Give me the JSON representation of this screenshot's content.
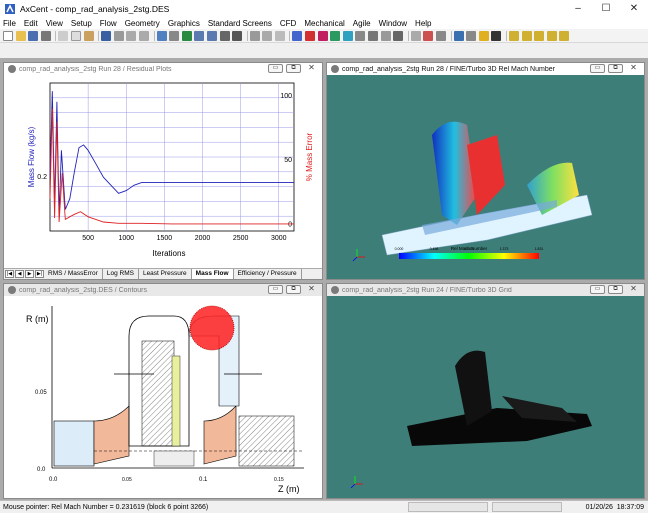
{
  "window": {
    "title": "AxCent - comp_rad_analysis_2stg.DES",
    "controls": [
      "–",
      "☐",
      "✕"
    ]
  },
  "menu": [
    "File",
    "Edit",
    "View",
    "Setup",
    "Flow",
    "Geometry",
    "Graphics",
    "Standard Screens",
    "CFD",
    "Mechanical",
    "Agile",
    "Window",
    "Help"
  ],
  "panes": {
    "residual": {
      "title": "comp_rad_analysis_2stg Run 28 / Residual Plots",
      "tabs": [
        "RMS / MassError",
        "Log RMS",
        "Least Pressure",
        "Mass Flow",
        "Efficiency / Pressure"
      ],
      "selected_tab": "Mass Flow"
    },
    "machnumber": {
      "title": "comp_rad_analysis_2stg Run 28 / FINE/Turbo 3D Rel Mach Number",
      "legend_title": "Rel Mach Number",
      "legend_ticks": [
        "0.000",
        "0.458",
        "0.915",
        "1.373",
        "1.831"
      ]
    },
    "contours": {
      "title": "comp_rad_analysis_2stg.DES / Contours",
      "ylabel": "R (m)",
      "xlabel": "Z (m)",
      "yticks": [
        "0.05",
        "0.0"
      ],
      "xticks": [
        "0.0",
        "0.05",
        "0.1",
        "0.15"
      ]
    },
    "grid": {
      "title": "comp_rad_analysis_2stg Run 24 / FINE/Turbo 3D Grid"
    }
  },
  "chart_data": {
    "type": "line",
    "xlabel": "Iterations",
    "ylabel": "Mass Flow (kg/s)",
    "y2label": "% Mass Error",
    "xlim": [
      0,
      3200
    ],
    "xticks": [
      500,
      1000,
      1500,
      2000,
      2500,
      3000
    ],
    "yticks": [
      0.2
    ],
    "y2ticks": [
      0,
      50,
      100
    ],
    "grid": true,
    "series": [
      {
        "axis": "left",
        "color": "#2222bb",
        "x": [
          0,
          30,
          60,
          90,
          120,
          150,
          200,
          260,
          320,
          380,
          440,
          500,
          600,
          700,
          800,
          900,
          1000,
          1100,
          1200,
          1400,
          1600,
          1800,
          2000,
          2400,
          2800,
          3200
        ],
        "y": [
          0.2,
          0.52,
          0.1,
          0.48,
          0.06,
          0.3,
          0.08,
          0.12,
          0.22,
          0.31,
          0.32,
          0.3,
          0.25,
          0.2,
          0.17,
          0.14,
          0.15,
          0.17,
          0.18,
          0.18,
          0.18,
          0.18,
          0.18,
          0.18,
          0.18,
          0.18
        ]
      },
      {
        "axis": "right",
        "color": "#dd2222",
        "x": [
          0,
          30,
          60,
          90,
          120,
          160,
          200,
          260,
          320,
          400,
          500,
          600,
          700,
          900,
          1200,
          1600,
          2000,
          2400,
          2800,
          3200
        ],
        "y": [
          20,
          90,
          5,
          80,
          2,
          40,
          4,
          6,
          8,
          10,
          6,
          4,
          2,
          1,
          1,
          0.5,
          0.5,
          0.5,
          0.5,
          0.5
        ]
      }
    ]
  },
  "status": {
    "message": "Mouse pointer:  Rel Mach Number = 0.231619  (block 6 point 3266)",
    "date": "01/20/26",
    "time": "18:37:09"
  },
  "colors": {
    "teal_background": "#3e7e79",
    "mdi_background": "#ababab"
  }
}
